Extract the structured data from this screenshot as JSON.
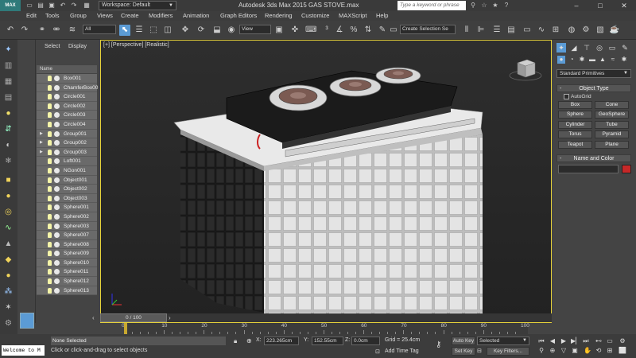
{
  "titlebar": {
    "logo": "MAX",
    "workspace_label": "Workspace: Default",
    "app_title": "Autodesk 3ds Max  2015      GAS STOVE.max",
    "search_placeholder": "Type a keyword or phrase",
    "quick_access_icons": [
      "new-icon",
      "open-icon",
      "save-icon",
      "undo-icon",
      "redo-icon",
      "project-folder-icon"
    ],
    "window_controls": [
      "minimize-icon",
      "maximize-icon",
      "close-icon"
    ]
  },
  "menubar": {
    "items": [
      "Edit",
      "Tools",
      "Group",
      "Views",
      "Create",
      "Modifiers",
      "Animation",
      "Graph Editors",
      "Rendering",
      "Customize",
      "MAXScript",
      "Help"
    ]
  },
  "toolbar": {
    "filter_value": "All",
    "view_value": "View",
    "selection_set_value": "Create Selection Se",
    "active_tool": "select-object"
  },
  "explorer": {
    "tabs": [
      "Select",
      "Display"
    ],
    "column_header": "Name",
    "items": [
      {
        "name": "Box001",
        "expandable": false
      },
      {
        "name": "ChamferBox00",
        "expandable": false
      },
      {
        "name": "Circle001",
        "expandable": false
      },
      {
        "name": "Circle002",
        "expandable": false
      },
      {
        "name": "Circle003",
        "expandable": false
      },
      {
        "name": "Circle004",
        "expandable": false
      },
      {
        "name": "Group001",
        "expandable": true
      },
      {
        "name": "Group002",
        "expandable": true
      },
      {
        "name": "Group003",
        "expandable": true
      },
      {
        "name": "Loft001",
        "expandable": false
      },
      {
        "name": "NGon001",
        "expandable": false
      },
      {
        "name": "Object001",
        "expandable": false
      },
      {
        "name": "Object002",
        "expandable": false
      },
      {
        "name": "Object003",
        "expandable": false
      },
      {
        "name": "Sphere001",
        "expandable": false
      },
      {
        "name": "Sphere002",
        "expandable": false
      },
      {
        "name": "Sphere003",
        "expandable": false
      },
      {
        "name": "Sphere007",
        "expandable": false
      },
      {
        "name": "Sphere008",
        "expandable": false
      },
      {
        "name": "Sphere009",
        "expandable": false
      },
      {
        "name": "Sphere010",
        "expandable": false
      },
      {
        "name": "Sphere011",
        "expandable": false
      },
      {
        "name": "Sphere012",
        "expandable": false
      },
      {
        "name": "Sphere013",
        "expandable": false
      }
    ]
  },
  "viewport": {
    "label": "[+] [Perspective] [Realistic]",
    "border_color": "#e7d33a"
  },
  "command_panel": {
    "primitive_type": "Standard Primitives",
    "object_type_title": "Object Type",
    "autogrid_label": "AutoGrid",
    "primitives": [
      "Box",
      "Cone",
      "Sphere",
      "GeoSphere",
      "Cylinder",
      "Tube",
      "Torus",
      "Pyramid",
      "Teapot",
      "Plane"
    ],
    "name_color_title": "Name and Color",
    "object_color": "#c62828"
  },
  "timeline": {
    "slider_label": "0 / 100",
    "ticks": [
      "0",
      "10",
      "20",
      "30",
      "40",
      "50",
      "60",
      "70",
      "80",
      "90",
      "100"
    ]
  },
  "status": {
    "listener_text": "Welcome to M",
    "selection_status": "None Selected",
    "prompt": "Click or click-and-drag to select objects",
    "x_label": "X:",
    "x_value": "223.265cm",
    "y_label": "Y:",
    "y_value": "152.55cm",
    "z_label": "Z:",
    "z_value": "0.0cm",
    "grid_readout": "Grid = 25.4cm",
    "add_time_tag": "Add Time Tag",
    "auto_key": "Auto Key",
    "set_key": "Set Key",
    "key_mode_value": "Selected",
    "key_filters": "Key Filters..."
  }
}
